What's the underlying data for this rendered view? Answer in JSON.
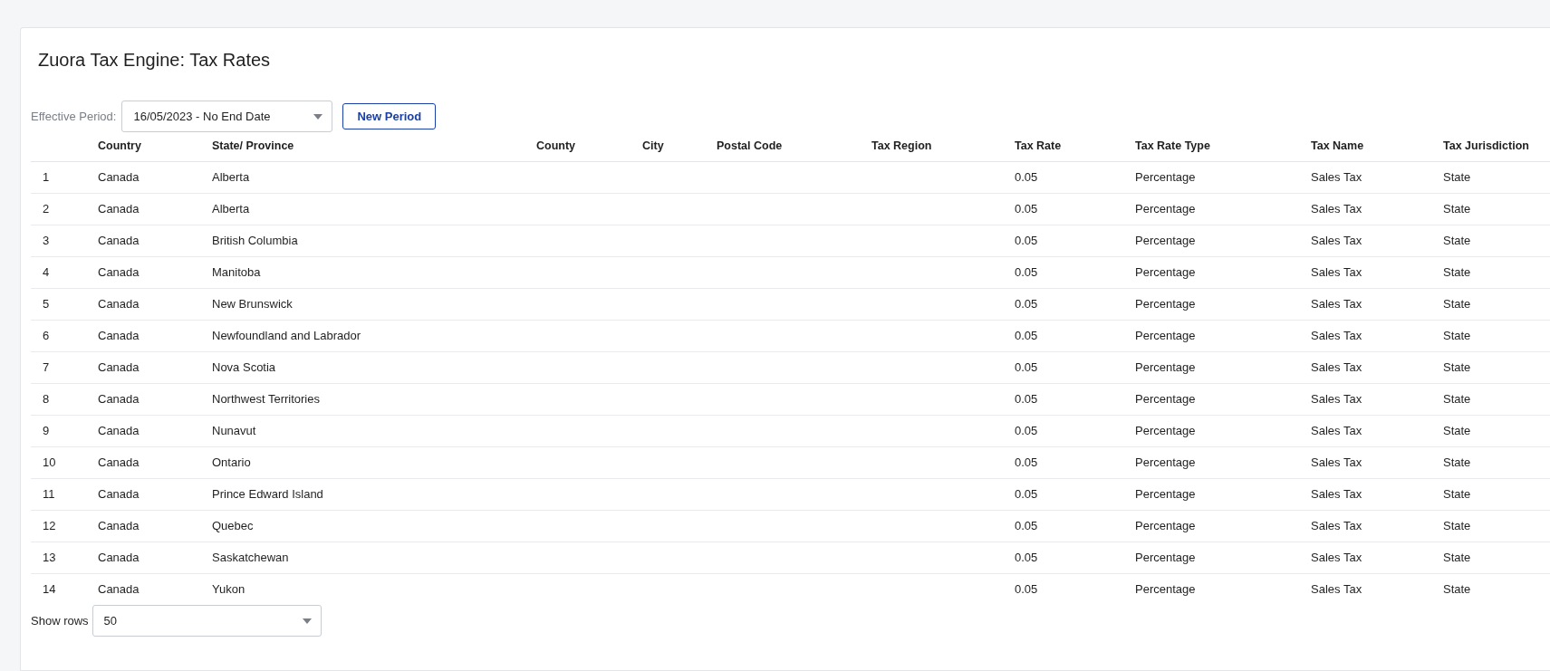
{
  "title": "Zuora Tax Engine: Tax Rates",
  "effective_period": {
    "label": "Effective Period:",
    "value": "16/05/2023 - No End Date"
  },
  "new_period_button": "New Period",
  "table": {
    "columns": [
      "Country",
      "State/ Province",
      "County",
      "City",
      "Postal Code",
      "Tax Region",
      "Tax Rate",
      "Tax Rate Type",
      "Tax Name",
      "Tax Jurisdiction"
    ],
    "rows": [
      {
        "number": "1",
        "cells": [
          "Canada",
          "Alberta",
          null,
          null,
          null,
          null,
          "0.05",
          "Percentage",
          "Sales Tax",
          "State"
        ]
      },
      {
        "number": "2",
        "cells": [
          "Canada",
          "Alberta",
          null,
          null,
          null,
          null,
          "0.05",
          "Percentage",
          "Sales Tax",
          "State"
        ]
      },
      {
        "number": "3",
        "cells": [
          "Canada",
          "British Columbia",
          null,
          null,
          null,
          null,
          "0.05",
          "Percentage",
          "Sales Tax",
          "State"
        ]
      },
      {
        "number": "4",
        "cells": [
          "Canada",
          "Manitoba",
          null,
          null,
          null,
          null,
          "0.05",
          "Percentage",
          "Sales Tax",
          "State"
        ]
      },
      {
        "number": "5",
        "cells": [
          "Canada",
          "New Brunswick",
          null,
          null,
          null,
          null,
          "0.05",
          "Percentage",
          "Sales Tax",
          "State"
        ]
      },
      {
        "number": "6",
        "cells": [
          "Canada",
          "Newfoundland and Labrador",
          null,
          null,
          null,
          null,
          "0.05",
          "Percentage",
          "Sales Tax",
          "State"
        ]
      },
      {
        "number": "7",
        "cells": [
          "Canada",
          "Nova Scotia",
          null,
          null,
          null,
          null,
          "0.05",
          "Percentage",
          "Sales Tax",
          "State"
        ]
      },
      {
        "number": "8",
        "cells": [
          "Canada",
          "Northwest Territories",
          null,
          null,
          null,
          null,
          "0.05",
          "Percentage",
          "Sales Tax",
          "State"
        ]
      },
      {
        "number": "9",
        "cells": [
          "Canada",
          "Nunavut",
          null,
          null,
          null,
          null,
          "0.05",
          "Percentage",
          "Sales Tax",
          "State"
        ]
      },
      {
        "number": "10",
        "cells": [
          "Canada",
          "Ontario",
          null,
          null,
          null,
          null,
          "0.05",
          "Percentage",
          "Sales Tax",
          "State"
        ]
      },
      {
        "number": "11",
        "cells": [
          "Canada",
          "Prince Edward Island",
          null,
          null,
          null,
          null,
          "0.05",
          "Percentage",
          "Sales Tax",
          "State"
        ]
      },
      {
        "number": "12",
        "cells": [
          "Canada",
          "Quebec",
          null,
          null,
          null,
          null,
          "0.05",
          "Percentage",
          "Sales Tax",
          "State"
        ]
      },
      {
        "number": "13",
        "cells": [
          "Canada",
          "Saskatchewan",
          null,
          null,
          null,
          null,
          "0.05",
          "Percentage",
          "Sales Tax",
          "State"
        ]
      },
      {
        "number": "14",
        "cells": [
          "Canada",
          "Yukon",
          null,
          null,
          null,
          null,
          "0.05",
          "Percentage",
          "Sales Tax",
          "State"
        ]
      }
    ]
  },
  "show_rows": {
    "label": "Show rows",
    "value": "50"
  }
}
